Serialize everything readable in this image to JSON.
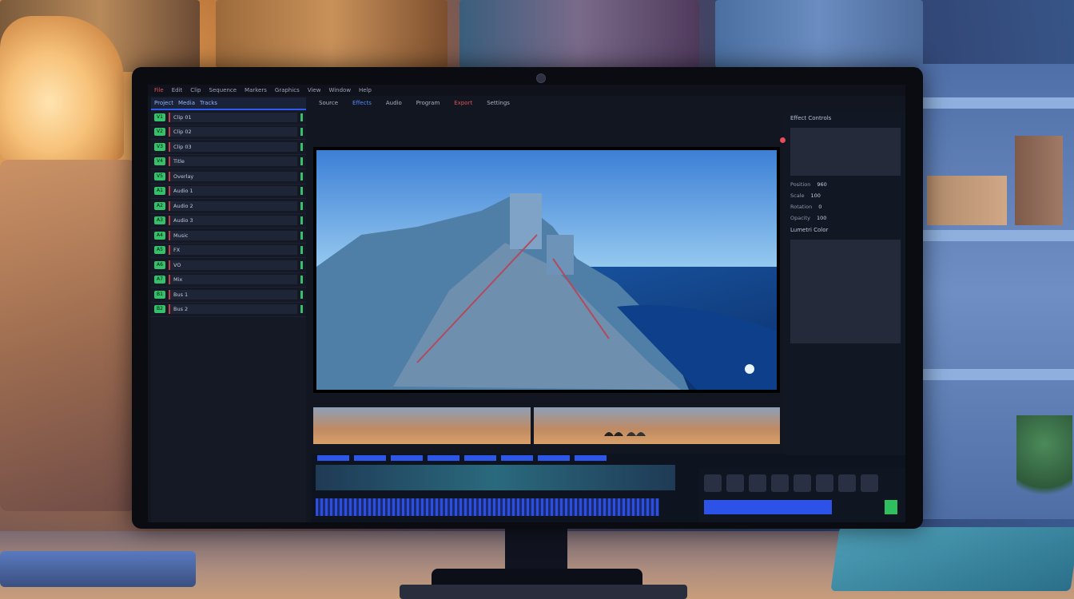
{
  "menu_bar": {
    "items": [
      "File",
      "Edit",
      "Clip",
      "Sequence",
      "Markers",
      "Graphics",
      "View",
      "Window",
      "Help"
    ]
  },
  "toolbar": {
    "items": [
      "Source",
      "Effects",
      "Audio",
      "Program",
      "Export",
      "Settings"
    ]
  },
  "left_panel": {
    "header": [
      "Project",
      "Media",
      "Tracks"
    ],
    "tracks": [
      {
        "num": "V1",
        "label": "Clip 01",
        "color": "#36c06a"
      },
      {
        "num": "V2",
        "label": "Clip 02",
        "color": "#36c06a"
      },
      {
        "num": "V3",
        "label": "Clip 03",
        "color": "#36c06a"
      },
      {
        "num": "V4",
        "label": "Title",
        "color": "#36c06a"
      },
      {
        "num": "V5",
        "label": "Overlay",
        "color": "#36c06a"
      },
      {
        "num": "A1",
        "label": "Audio 1",
        "color": "#36c06a"
      },
      {
        "num": "A2",
        "label": "Audio 2",
        "color": "#36c06a"
      },
      {
        "num": "A3",
        "label": "Audio 3",
        "color": "#36c06a"
      },
      {
        "num": "A4",
        "label": "Music",
        "color": "#36c06a"
      },
      {
        "num": "A5",
        "label": "FX",
        "color": "#36c06a"
      },
      {
        "num": "A6",
        "label": "VO",
        "color": "#36c06a"
      },
      {
        "num": "A7",
        "label": "Mix",
        "color": "#36c06a"
      },
      {
        "num": "B1",
        "label": "Bus 1",
        "color": "#36c06a"
      },
      {
        "num": "B2",
        "label": "Bus 2",
        "color": "#36c06a"
      }
    ]
  },
  "right_panel": {
    "title": "Effect Controls",
    "rows": [
      {
        "key": "Position",
        "value": "960"
      },
      {
        "key": "Scale",
        "value": "100"
      },
      {
        "key": "Rotation",
        "value": "0"
      },
      {
        "key": "Opacity",
        "value": "100"
      }
    ],
    "section2_title": "Lumetri Color"
  },
  "colors": {
    "accent": "#2d5cf0",
    "record": "#e94c5a",
    "marker": "#36c06a"
  }
}
